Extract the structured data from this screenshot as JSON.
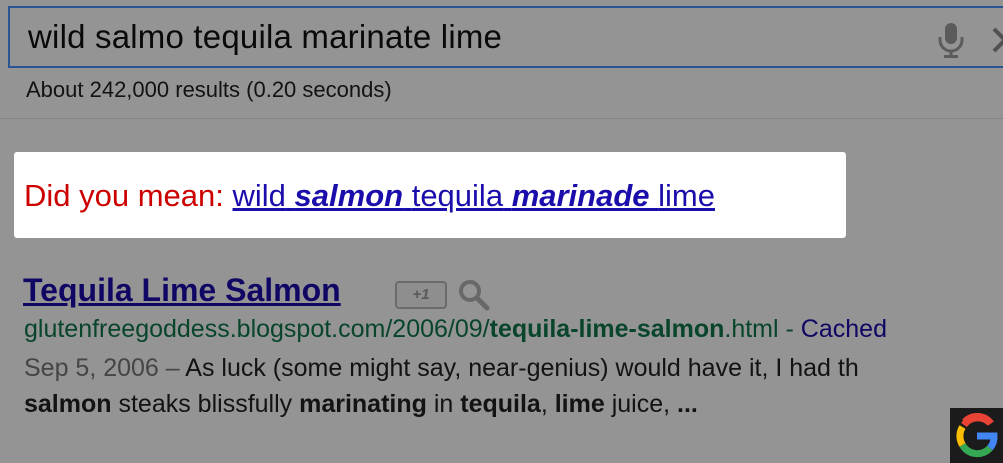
{
  "search": {
    "query": "wild salmo tequila marinate lime",
    "results_stats": "About 242,000 results (0.20 seconds)"
  },
  "spelling": {
    "label": "Did you mean:",
    "suggestion": {
      "word1": "wild",
      "word2": "salmon",
      "word3": "tequila",
      "word4": "marinade",
      "word5": "lime"
    }
  },
  "result": {
    "title": "Tequila Lime Salmon",
    "plusone_label": "+1",
    "url_prefix": "glutenfreegoddess.blogspot.com/2006/09/",
    "url_bold": "tequila-lime-salmon",
    "url_suffix": ".html",
    "url_separator": " - ",
    "cache_label": "Cached",
    "snippet_date": "Sep 5, 2006",
    "snippet_dash": " – ",
    "snippet_line1_text": "As luck (some might say, near-genius) would have it, I had th",
    "snippet_line2": {
      "b1": "salmon",
      "t1": " steaks blissfully ",
      "b2": "marinating",
      "t2": " in ",
      "b3": "tequila",
      "t3": ", ",
      "b4": "lime",
      "t4": " juice, ",
      "b5": "..."
    }
  },
  "icons": {
    "mic": "microphone-icon",
    "clear": "close-icon",
    "preview": "magnifier-icon",
    "brand": "google-g-logo"
  },
  "colors": {
    "link": "#1a0dab",
    "url_green": "#0e774a",
    "did_you_mean_red": "#cc0000",
    "search_border": "#4d90fe"
  }
}
